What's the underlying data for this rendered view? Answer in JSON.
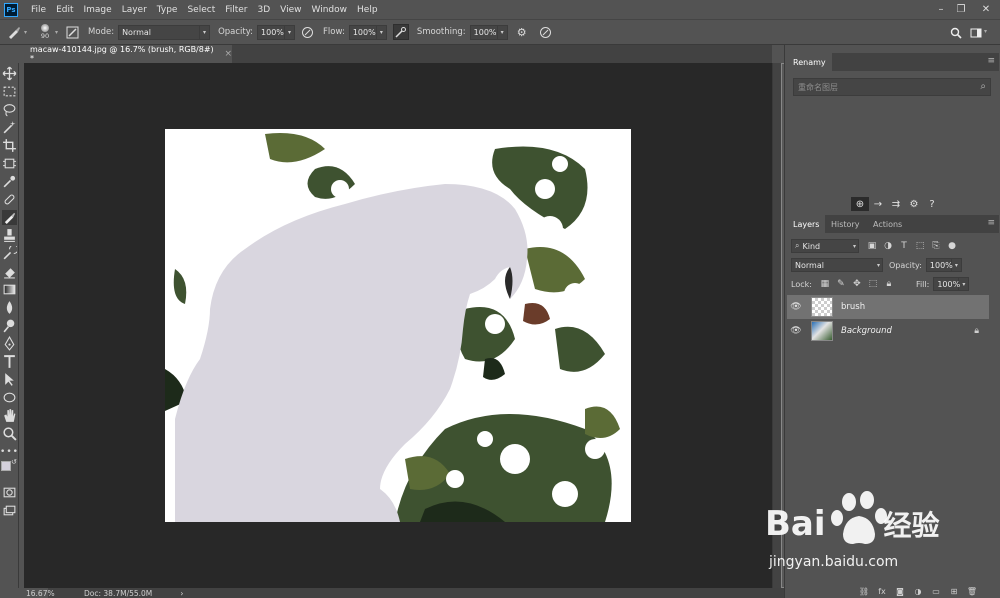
{
  "app": {
    "logo_text": "Ps"
  },
  "menubar": {
    "items": [
      "File",
      "Edit",
      "Image",
      "Layer",
      "Type",
      "Select",
      "Filter",
      "3D",
      "View",
      "Window",
      "Help"
    ],
    "controls": [
      "–",
      "❐",
      "✕"
    ]
  },
  "options_bar": {
    "brush_size": "90",
    "mode_label": "Mode:",
    "mode_value": "Normal",
    "opacity_label": "Opacity:",
    "opacity_value": "100%",
    "flow_label": "Flow:",
    "flow_value": "100%",
    "smoothing_label": "Smoothing:",
    "smoothing_value": "100%"
  },
  "document_tab": {
    "title": "macaw-410144.jpg @ 16.7% (brush, RGB/8#) *",
    "close": "×"
  },
  "status_bar": {
    "zoom": "16.67%",
    "doc_info": "Doc: 38.7M/55.0M",
    "arrow": "›"
  },
  "panels": {
    "renamy": {
      "tab_label": "Renamy",
      "search_placeholder": "重命名图层"
    },
    "layers_tabs": [
      "Layers",
      "History",
      "Actions"
    ],
    "kind_filter": "Kind",
    "blend_mode": "Normal",
    "opacity_label": "Opacity:",
    "opacity_value": "100%",
    "lock_label": "Lock:",
    "fill_label": "Fill:",
    "fill_value": "100%",
    "layers": [
      {
        "name": "brush",
        "selected": true
      },
      {
        "name": "Background",
        "selected": false,
        "locked": true
      }
    ]
  },
  "watermark": {
    "brand_latin": "Bai",
    "brand_cn": "经验",
    "url": "jingyan.baidu.com"
  },
  "colors": {
    "ui_bg": "#535353",
    "canvas_bg": "#282828",
    "panel_dark": "#424242",
    "brush_fill": "#d9d6df",
    "foliage_dark": "#2f4226",
    "foliage_mid": "#5a6b3a",
    "bokeh_white": "#ffffff"
  },
  "icons": {
    "tools": [
      "move-icon",
      "marquee-icon",
      "lasso-icon",
      "magic-wand-icon",
      "crop-icon",
      "frame-icon",
      "eyedropper-icon",
      "healing-icon",
      "brush-icon",
      "stamp-icon",
      "history-brush-icon",
      "eraser-icon",
      "gradient-icon",
      "blur-icon",
      "dodge-icon",
      "pen-icon",
      "type-icon",
      "path-select-icon",
      "shape-icon",
      "hand-icon",
      "zoom-icon",
      "more-tools-icon"
    ]
  }
}
